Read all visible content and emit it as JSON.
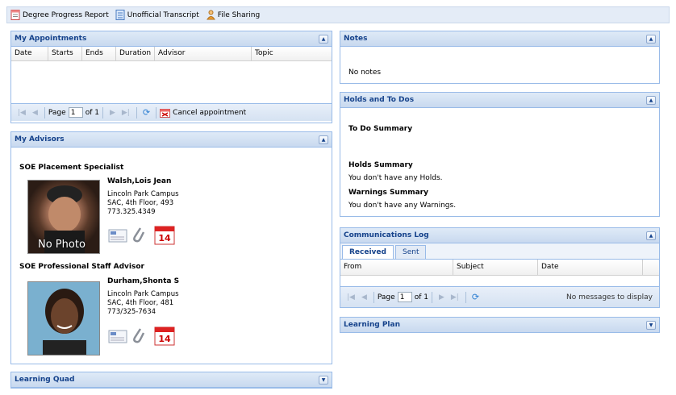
{
  "toolbar": {
    "items": [
      {
        "label": "Degree Progress Report",
        "icon": "report-icon"
      },
      {
        "label": "Unofficial Transcript",
        "icon": "document-icon"
      },
      {
        "label": "File Sharing",
        "icon": "file-sharing-icon"
      }
    ]
  },
  "appointments": {
    "title": "My Appointments",
    "columns": [
      "Date",
      "Starts",
      "Ends",
      "Duration",
      "Advisor",
      "Topic"
    ],
    "pager": {
      "page_label": "Page",
      "page_value": "1",
      "of_label": "of 1",
      "cancel_label": "Cancel appointment"
    }
  },
  "advisors": {
    "title": "My Advisors",
    "list": [
      {
        "category": "SOE Placement Specialist",
        "name": "Walsh,Lois Jean",
        "campus": "Lincoln Park Campus",
        "address": "SAC, 4th Floor, 493",
        "phone": "773.325.4349",
        "photo_caption": "No Photo"
      },
      {
        "category": "SOE Professional Staff Advisor",
        "name": "Durham,Shonta S",
        "campus": "Lincoln Park Campus",
        "address": "SAC, 4th Floor, 481",
        "phone": "773/325-7634"
      }
    ],
    "calendar_day": "14"
  },
  "learning_quad": {
    "title": "Learning Quad"
  },
  "notes": {
    "title": "Notes",
    "body": "No notes"
  },
  "holds": {
    "title": "Holds and To Dos",
    "todo_heading": "To Do Summary",
    "holds_heading": "Holds Summary",
    "holds_text": "You don't have any Holds.",
    "warnings_heading": "Warnings Summary",
    "warnings_text": "You don't have any Warnings."
  },
  "comms": {
    "title": "Communications Log",
    "tabs": [
      "Received",
      "Sent"
    ],
    "columns": [
      "From",
      "Subject",
      "Date"
    ],
    "pager": {
      "page_label": "Page",
      "page_value": "1",
      "of_label": "of 1",
      "empty_msg": "No messages to display"
    }
  },
  "learning_plan": {
    "title": "Learning Plan"
  }
}
